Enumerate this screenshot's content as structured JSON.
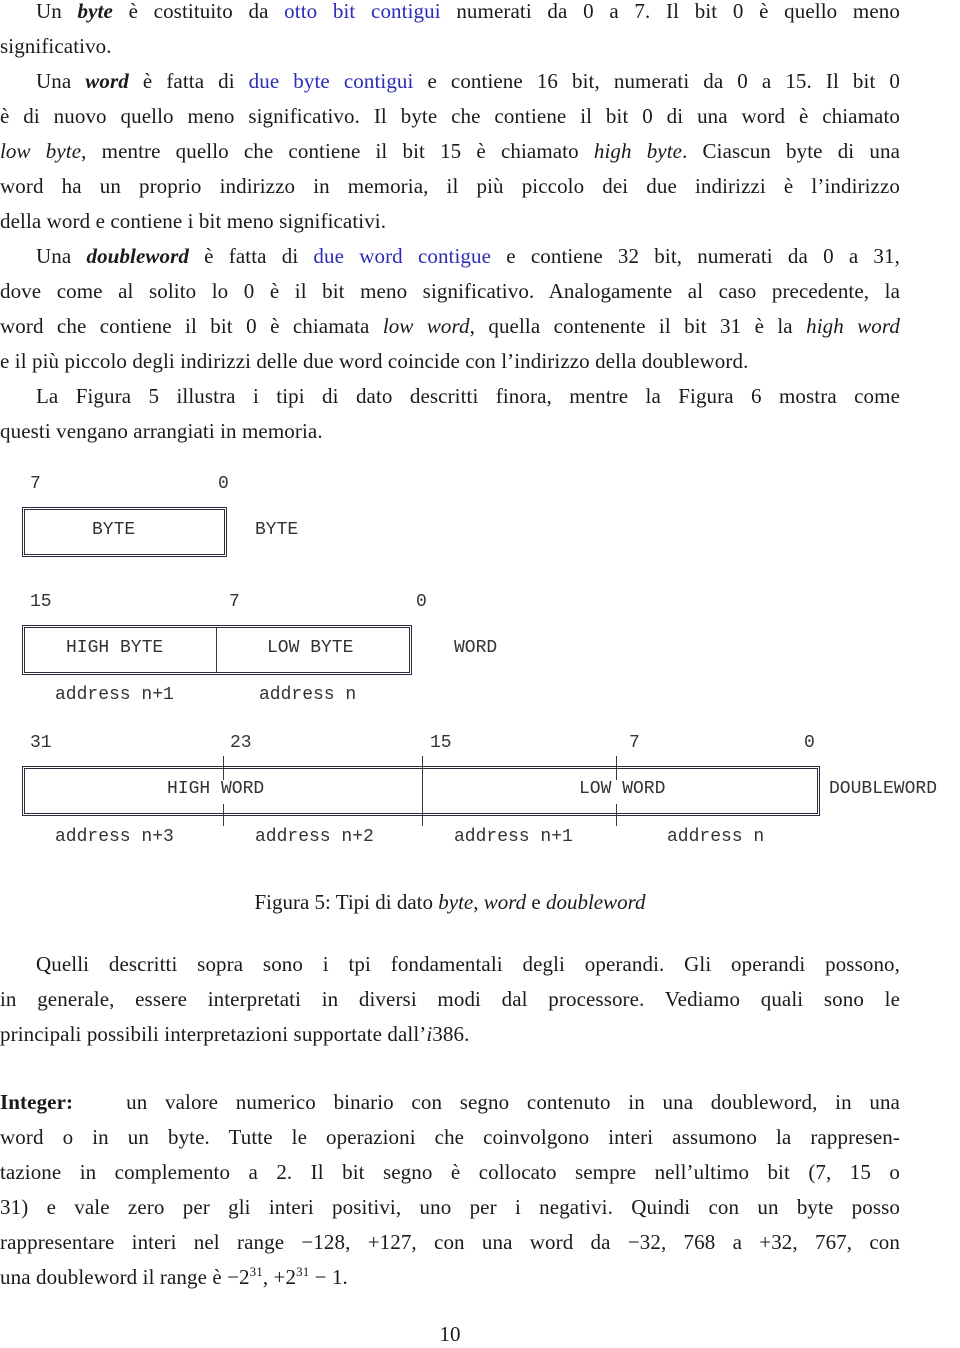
{
  "paragraphs": {
    "byte": {
      "lines": [
        [
          "Un ",
          {
            "b": "byte"
          },
          " è costituito da ",
          {
            "link": "otto bit contigui"
          },
          " numerati da 0 a 7. Il bit 0 è quello meno"
        ],
        [
          "significativo."
        ]
      ],
      "l1_a": "Un ",
      "l1_term": "byte",
      "l1_b": " è costituito da ",
      "l1_link": "otto bit contigui",
      "l1_c": " numerati da 0 a 7.  Il bit 0 è quello meno",
      "l2": "significativo."
    },
    "word": {
      "l1_a": "Una ",
      "l1_term": "word",
      "l1_b": " è fatta di ",
      "l1_link": "due byte contigui",
      "l1_c": " e contiene 16 bit, numerati da 0 a 15. Il bit 0",
      "l2": "è di nuovo quello meno significativo.  Il byte che contiene il bit 0 di una word è chiamato",
      "l3_it1": "low byte",
      "l3_a": ", mentre quello che contiene il bit 15 è chiamato ",
      "l3_it2": "high byte",
      "l3_b": ".  Ciascun byte di una",
      "l4": "word ha un proprio indirizzo in memoria, il più piccolo dei due indirizzi è l’indirizzo",
      "l5": "della word e contiene i bit meno significativi."
    },
    "doubleword": {
      "l1_a": "Una ",
      "l1_term": "doubleword",
      "l1_b": " è fatta di ",
      "l1_link": "due word contigue",
      "l1_c": " e contiene 32 bit, numerati da 0 a 31,",
      "l2": "dove come al solito lo 0 è il bit meno significativo.  Analogamente al caso precedente, la",
      "l3_a": "word che contiene il bit 0 è chiamata ",
      "l3_it1": "low word",
      "l3_b": ", quella contenente il bit 31 è la ",
      "l3_it2": "high word",
      "l4": "e il più piccolo degli indirizzi delle due word coincide con l’indirizzo della doubleword."
    },
    "figure_ref": {
      "l1": "La Figura 5 illustra i tipi di dato descritti finora, mentre la Figura 6 mostra come",
      "l2": "questi vengano arrangiati in memoria."
    },
    "operands": {
      "l1": "Quelli descritti sopra sono i tpi fondamentali degli operandi. Gli operandi possono,",
      "l2": "in generale, essere interpretati in diversi modi dal processore.  Vediamo quali sono le",
      "l3_a": "principali possibili interpretazioni supportate dall’",
      "l3_it": "i",
      "l3_b": "386."
    },
    "integer": {
      "label": "Integer:",
      "l1": "un valore numerico binario con segno contenuto in una doubleword, in una",
      "l2": "word o in un byte.  Tutte le operazioni che coinvolgono interi assumono la rappresen-",
      "l3": "tazione in complemento a 2.  Il bit segno è collocato sempre nell’ultimo bit (7, 15 o",
      "l4": "31) e vale zero per gli interi positivi, uno per i negativi.  Quindi con un byte posso",
      "l5": "rappresentare interi nel range −128, +127, con una word da −32, 768 a +32, 767, con",
      "l6_a": "una doubleword il range è −2",
      "l6_sup1": "31",
      "l6_b": ", +2",
      "l6_sup2": "31",
      "l6_c": " − 1."
    }
  },
  "figure": {
    "byte_row": {
      "bit_labels": [
        "7",
        "0"
      ],
      "cell": "BYTE",
      "type_label": "BYTE"
    },
    "word_row": {
      "bit_labels": [
        "15",
        "7",
        "0"
      ],
      "cells": [
        "HIGH BYTE",
        "LOW BYTE"
      ],
      "type_label": "WORD",
      "addresses": [
        "address n+1",
        "address n"
      ]
    },
    "doubleword_row": {
      "bit_labels": [
        "31",
        "23",
        "15",
        "7",
        "0"
      ],
      "cells": [
        "HIGH WORD",
        "LOW WORD"
      ],
      "type_label": "DOUBLEWORD",
      "addresses": [
        "address n+3",
        "address n+2",
        "address n+1",
        "address n"
      ]
    },
    "caption": {
      "a": "Figura 5: Tipi di dato ",
      "it1": "byte",
      "b": ", ",
      "it2": "word",
      "c": " e ",
      "it3": "doubleword"
    }
  },
  "page_number": "10",
  "colors": {
    "link": "#2b2bb8",
    "text": "#1a1a1a"
  }
}
